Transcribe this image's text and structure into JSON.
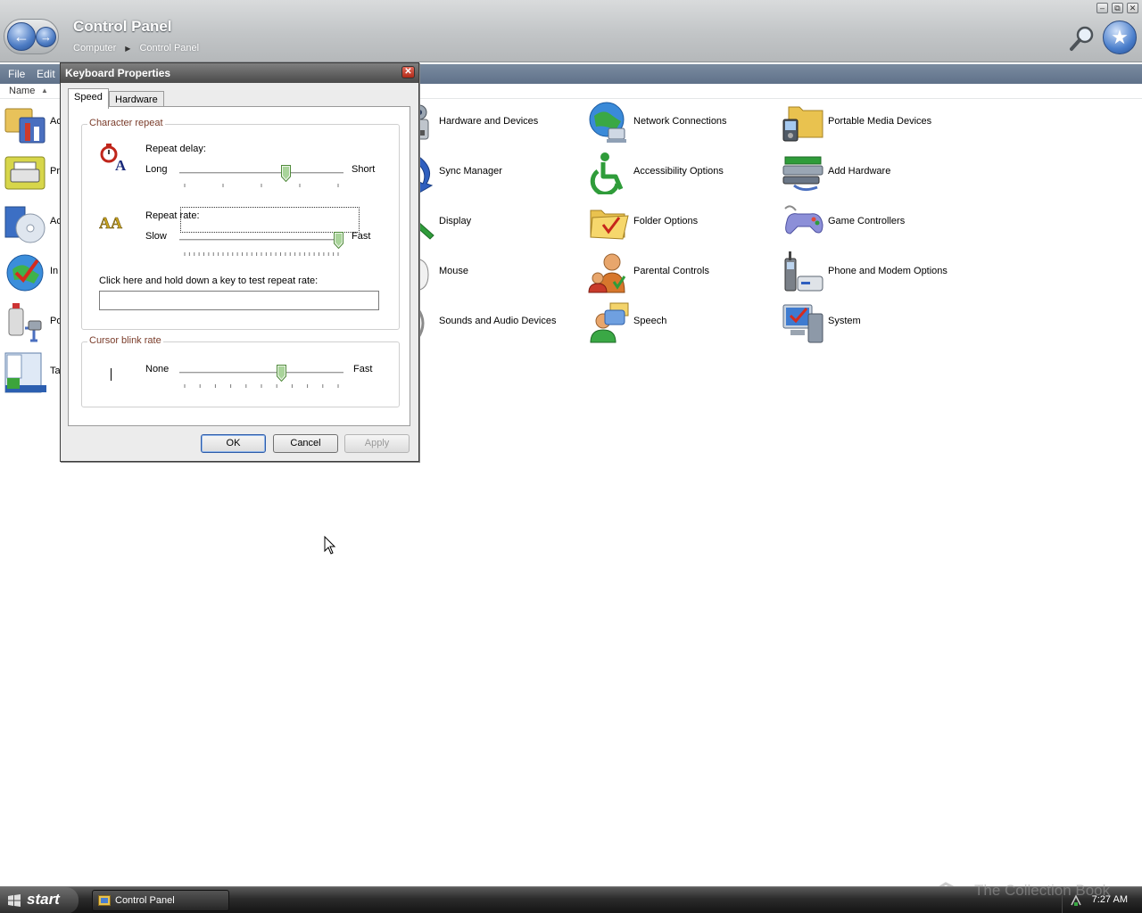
{
  "window": {
    "title": "Control Panel",
    "breadcrumbs": [
      "Computer",
      "Control Panel"
    ]
  },
  "menu": {
    "file": "File",
    "edit": "Edit"
  },
  "list_header": {
    "name": "Name"
  },
  "left_items": [
    {
      "frag": "Ac",
      "icon": "admin-tools-icon"
    },
    {
      "frag": "Pr",
      "icon": "printers-icon"
    },
    {
      "frag": "Ac",
      "icon": "add-remove-programs-icon"
    },
    {
      "frag": "In",
      "icon": "internet-options-icon"
    },
    {
      "frag": "Po",
      "icon": "power-options-icon"
    },
    {
      "frag": "Ta",
      "icon": "taskbar-start-menu-icon"
    }
  ],
  "items": [
    {
      "label": "Hardware and Devices",
      "icon": "hardware-devices-icon"
    },
    {
      "label": "Network Connections",
      "icon": "network-connections-icon"
    },
    {
      "label": "Portable Media Devices",
      "icon": "portable-media-icon"
    },
    {
      "label": "Sync Manager",
      "icon": "sync-manager-icon"
    },
    {
      "label": "Accessibility Options",
      "icon": "accessibility-icon"
    },
    {
      "label": "Add Hardware",
      "icon": "add-hardware-icon"
    },
    {
      "label": "Display",
      "icon": "display-icon"
    },
    {
      "label": "Folder Options",
      "icon": "folder-options-icon"
    },
    {
      "label": "Game Controllers",
      "icon": "game-controllers-icon"
    },
    {
      "label": "Mouse",
      "icon": "mouse-icon"
    },
    {
      "label": "Parental Controls",
      "icon": "parental-controls-icon"
    },
    {
      "label": "Phone and Modem Options",
      "icon": "phone-modem-icon"
    },
    {
      "label": "Sounds and Audio Devices",
      "icon": "sounds-audio-icon"
    },
    {
      "label": "Speech",
      "icon": "speech-icon"
    },
    {
      "label": "System",
      "icon": "system-icon"
    }
  ],
  "dialog": {
    "title": "Keyboard Properties",
    "tabs": [
      "Speed",
      "Hardware"
    ],
    "active_tab": "Speed",
    "character_repeat": {
      "group_label": "Character repeat",
      "delay_label": "Repeat delay:",
      "delay_min": "Long",
      "delay_max": "Short",
      "delay_level": 0.66,
      "rate_label": "Repeat rate:",
      "rate_min": "Slow",
      "rate_max": "Fast",
      "rate_level": 1.0,
      "test_label": "Click here and hold down a key to test repeat rate:",
      "test_value": ""
    },
    "cursor_blink": {
      "group_label": "Cursor blink rate",
      "min": "None",
      "max": "Fast",
      "level": 0.63
    },
    "buttons": {
      "ok": "OK",
      "cancel": "Cancel",
      "apply": "Apply"
    }
  },
  "taskbar": {
    "start": "start",
    "task": "Control Panel",
    "clock": "7:27 AM"
  },
  "watermark": "The Collection Book"
}
